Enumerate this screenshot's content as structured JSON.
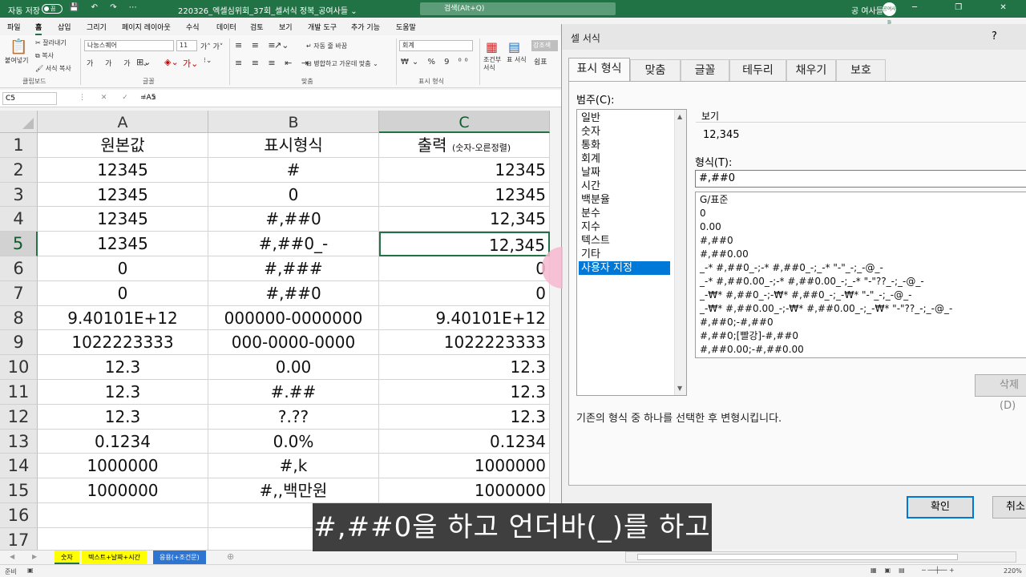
{
  "titlebar": {
    "autosave_label": "자동 저장",
    "autosave_state": "끔",
    "qat_icons": "💾 ↶ ↷ ⋯",
    "document_title": "220326_엑셀심위회_37회_셀서식 정복_공여사들 ⌄",
    "search_placeholder": "검색(Alt+Q)",
    "user_name": "공 여사들",
    "avatar_text": "공여사들",
    "window_buttons": "─ ❐ ✕"
  },
  "menu_tabs": [
    "파일",
    "홈",
    "삽입",
    "그리기",
    "페이지 레이아웃",
    "수식",
    "데이터",
    "검토",
    "보기",
    "개발 도구",
    "추가 기능",
    "도움말"
  ],
  "ribbon": {
    "paste_label": "붙여넣기",
    "cut_label": "잘라내기",
    "copy_label": "복사",
    "format_painter_label": "서식 복사",
    "clipboard_group": "클립보드",
    "font_name": "나눔스퀘어",
    "font_size": "11",
    "font_group": "글꼴",
    "wrap_text": "자동 줄 바꿈",
    "merge_center": "병합하고 가운데 맞춤",
    "align_group": "맞춤",
    "number_format": "회계",
    "number_group": "표시 형식",
    "conditional_label": "조건부 서식",
    "table_label": "표 서식",
    "style_label": "강조색",
    "style_label2": "쉼표"
  },
  "formula_bar": {
    "name_box": "C5",
    "formula": "=A5"
  },
  "grid": {
    "columns": [
      "A",
      "B",
      "C"
    ],
    "rows": [
      {
        "n": "1",
        "a": "원본값",
        "b": "표시형식",
        "c": "출력",
        "c_note": "(숫자-오른정렬)"
      },
      {
        "n": "2",
        "a": "12345",
        "b": "#",
        "c": "12345"
      },
      {
        "n": "3",
        "a": "12345",
        "b": "0",
        "c": "12345"
      },
      {
        "n": "4",
        "a": "12345",
        "b": "#,##0",
        "c": "12,345"
      },
      {
        "n": "5",
        "a": "12345",
        "b": "#,##0_-",
        "c": "12,345"
      },
      {
        "n": "6",
        "a": "0",
        "b": "#,###",
        "c": "0"
      },
      {
        "n": "7",
        "a": "0",
        "b": "#,##0",
        "c": "0"
      },
      {
        "n": "8",
        "a": "9.40101E+12",
        "b": "000000-0000000",
        "c": "9.40101E+12"
      },
      {
        "n": "9",
        "a": "1022223333",
        "b": "000-0000-0000",
        "c": "1022223333"
      },
      {
        "n": "10",
        "a": "12.3",
        "b": "0.00",
        "c": "12.3"
      },
      {
        "n": "11",
        "a": "12.3",
        "b": "#.##",
        "c": "12.3"
      },
      {
        "n": "12",
        "a": "12.3",
        "b": "?.??",
        "c": "12.3"
      },
      {
        "n": "13",
        "a": "0.1234",
        "b": "0.0%",
        "c": "0.1234"
      },
      {
        "n": "14",
        "a": "1000000",
        "b": "#,k",
        "c": "1000000"
      },
      {
        "n": "15",
        "a": "1000000",
        "b": "#,,백만원",
        "c": "1000000"
      },
      {
        "n": "16",
        "a": "",
        "b": "",
        "c": ""
      },
      {
        "n": "17",
        "a": "",
        "b": "",
        "c": ""
      }
    ]
  },
  "sheet_tabs": [
    {
      "label": "숫자",
      "color": "#ffff00"
    },
    {
      "label": "텍스트+날짜+시간",
      "color": "#ffff00"
    },
    {
      "label": "응용(+조건문)",
      "color": "#2e75d1"
    }
  ],
  "status": {
    "ready": "준비",
    "zoom": "220%"
  },
  "dialog": {
    "title": "셀 서식",
    "help": "?",
    "tabs": [
      "표시 형식",
      "맞춤",
      "글꼴",
      "테두리",
      "채우기",
      "보호"
    ],
    "category_label": "범주(C):",
    "categories": [
      "일반",
      "숫자",
      "통화",
      "회계",
      "날짜",
      "시간",
      "백분율",
      "분수",
      "지수",
      "텍스트",
      "기타",
      "사용자 지정"
    ],
    "selected_category": "사용자 지정",
    "sample_label": "보기",
    "sample_value": "12,345",
    "format_label": "형식(T):",
    "format_value": "#,##0",
    "format_list": [
      "G/표준",
      "0",
      "0.00",
      "#,##0",
      "#,##0.00",
      "_-* #,##0_-;-* #,##0_-;_-* \"-\"_-;_-@_-",
      "_-* #,##0.00_-;-* #,##0.00_-;_-* \"-\"??_-;_-@_-",
      "_-₩* #,##0_-;-₩* #,##0_-;_-₩* \"-\"_-;_-@_-",
      "_-₩* #,##0.00_-;-₩* #,##0.00_-;_-₩* \"-\"??_-;_-@_-",
      "#,##0;-#,##0",
      "#,##0;[빨강]-#,##0",
      "#,##0.00;-#,##0.00"
    ],
    "delete_label": "삭제(D)",
    "description": "기존의 형식 중 하나를 선택한 후 변형시킵니다.",
    "ok_label": "확인",
    "cancel_label": "취소"
  },
  "subtitle": "#,##0을 하고 언더바(_)를 하고"
}
